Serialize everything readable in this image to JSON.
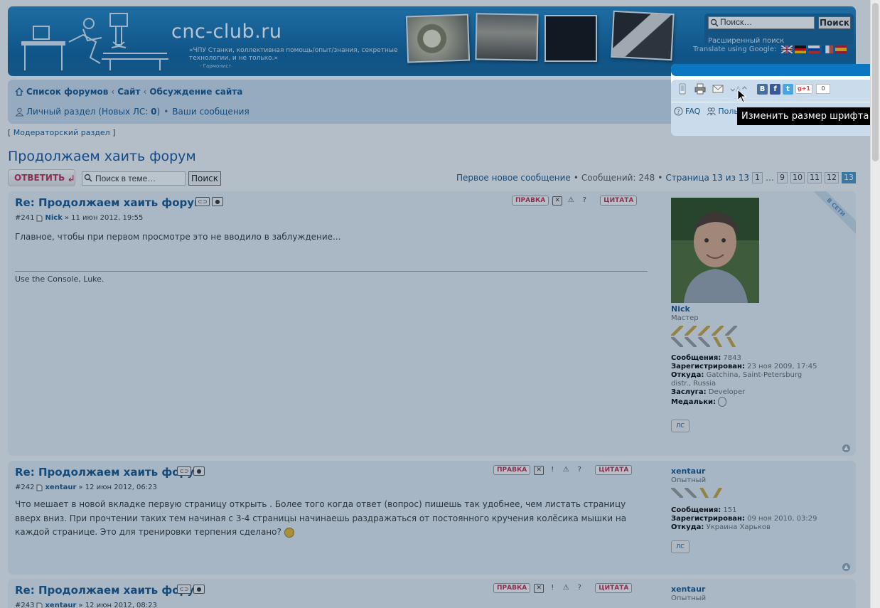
{
  "header": {
    "site_name": "cnc-club.ru",
    "tagline": "«ЧПУ Станки, коллективная помощь/опыт/знания, секретные технологии, и не только.»",
    "tagline_sig": "- Гармонист",
    "search_placeholder": "Поиск…",
    "search_button": "Поиск",
    "advanced_search": "Расширенный поиск",
    "translate_label": "Translate using Google:",
    "flags": [
      "en",
      "de",
      "ru",
      "fr",
      "es"
    ]
  },
  "navbar": {
    "breadcrumbs": [
      "Список форумов",
      "Сайт",
      "Обсуждение сайта"
    ],
    "pm_text": "Личный раздел (Новых ЛС: ",
    "pm_count": "0",
    "pm_close": ")",
    "bullet": "•",
    "your_posts": "Ваши сообщения",
    "faq": "FAQ",
    "users_partial": "Поль"
  },
  "moderator_link": "Модераторский раздел",
  "topic": {
    "title": "Продолжаем хаить форум",
    "reply_button": "ОТВЕТИТЬ",
    "search_placeholder": "Поиск в теме…",
    "search_button": "Поиск",
    "first_unread": "Первое новое сообщение",
    "posts_count_text": "Сообщений: 248",
    "page_text": "Страница 13 из 13",
    "pages": [
      "1",
      "…",
      "9",
      "10",
      "11",
      "12",
      "13"
    ],
    "current_page": "13"
  },
  "post_buttons": {
    "edit": "ПРАВКА",
    "quote": "ЦИТАТА"
  },
  "posts": [
    {
      "title": "Re: Продолжаем хаить форум",
      "number": "#241",
      "author": "Nick",
      "date": "» 11 июн 2012, 19:55",
      "body": "Главное, чтобы при первом просмотре это не вводило в заблуждение...",
      "signature": "Use the Console, Luke.",
      "online": "В СЕТИ",
      "profile": {
        "username": "Nick",
        "rank": "Мастер",
        "posts_label": "Сообщения:",
        "posts": "7843",
        "reg_label": "Зарегистрирован:",
        "reg": "23 ноя 2009, 17:45",
        "from_label": "Откуда:",
        "from": "Gatchina, Saint-Petersburg distr., Russia",
        "merit_label": "Заслуга:",
        "merit": "Developer",
        "medals_label": "Медальки:",
        "pm": "ЛС"
      }
    },
    {
      "title": "Re: Продолжаем хаить форум",
      "number": "#242",
      "author": "xentaur",
      "date": "» 12 июн 2012, 06:23",
      "body": "Что мешает в новой вкладке первую страницу открыть . Более того когда ответ (вопрос) пишешь так удобнее, чем листать страницу вверх вниз. При прочтении таких тем начиная с 3-4 страницы начинаешь раздражаться от постоянного кручения колёсика мышки на каждой странице. Это для тренировки терпения сделано?",
      "profile": {
        "username": "xentaur",
        "rank": "Опытный",
        "posts_label": "Сообщения:",
        "posts": "151",
        "reg_label": "Зарегистрирован:",
        "reg": "09 ноя 2010, 03:29",
        "from_label": "Откуда:",
        "from": "Украина Харьков",
        "pm": "ЛС"
      }
    },
    {
      "title": "Re: Продолжаем хаить форум",
      "number": "#243",
      "author": "xentaur",
      "date": "» 12 июн 2012, 08:23",
      "profile": {
        "username": "xentaur",
        "rank": "Опытный"
      }
    }
  ],
  "social": {
    "vk": "B",
    "fb": "f",
    "tw": "t",
    "gplus": "g+1",
    "gplus_count": "0"
  },
  "tooltip": "Изменить размер шрифта",
  "colors": {
    "header_blue": "#0a5f9c",
    "link": "#105289",
    "accent_red": "#bc2a4d",
    "nav_bg": "#cadceb"
  }
}
